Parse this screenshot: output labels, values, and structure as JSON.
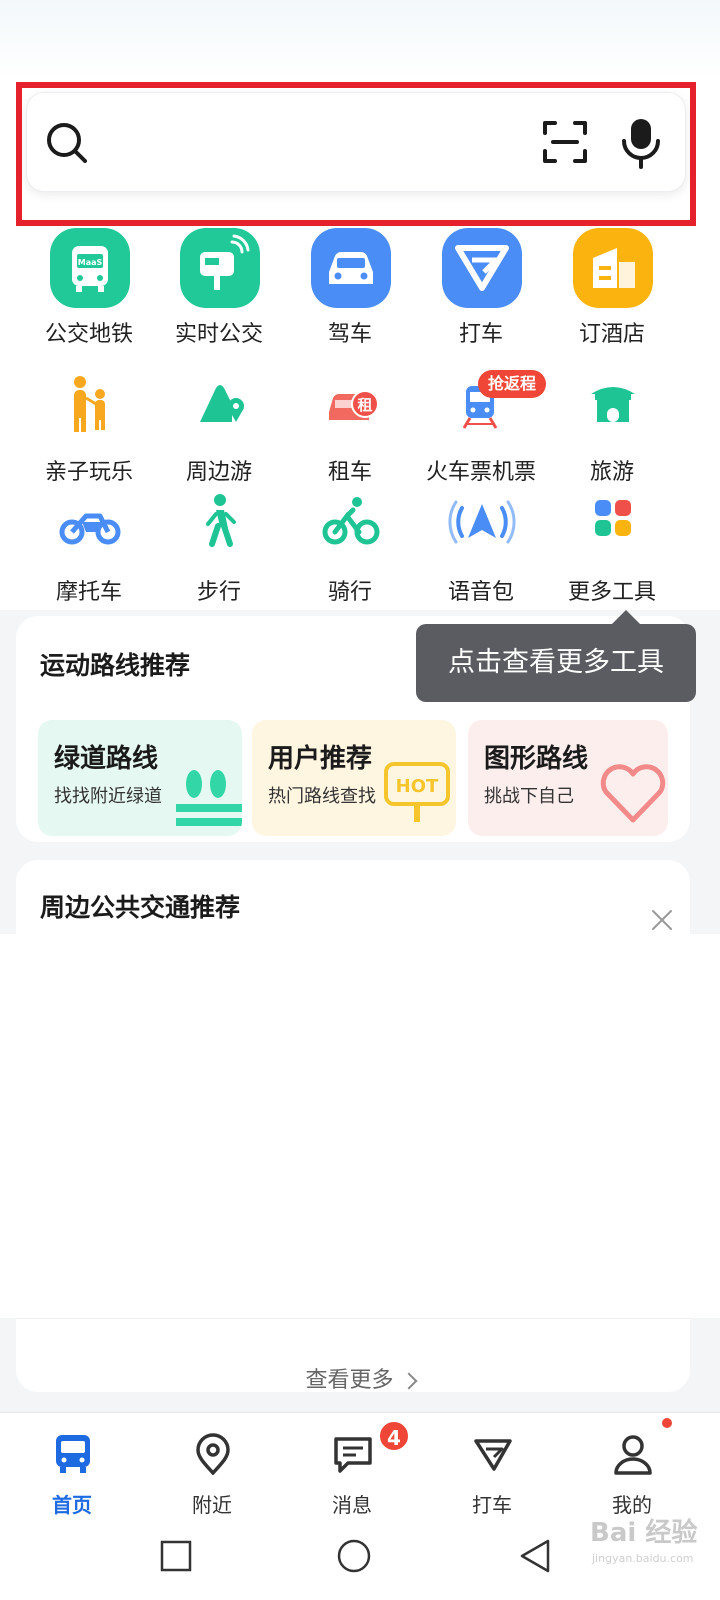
{
  "grid_items": [
    {
      "label": "公交地铁",
      "icon": "bus-metro-icon",
      "tile_text": "MaaS"
    },
    {
      "label": "实时公交",
      "icon": "realtime-bus-icon"
    },
    {
      "label": "驾车",
      "icon": "car-icon"
    },
    {
      "label": "打车",
      "icon": "taxi-icon"
    },
    {
      "label": "订酒店",
      "icon": "hotel-icon"
    },
    {
      "label": "亲子玩乐",
      "icon": "family-icon"
    },
    {
      "label": "周边游",
      "icon": "nearby-trip-icon"
    },
    {
      "label": "租车",
      "icon": "rent-car-icon",
      "tile_text": "租"
    },
    {
      "label": "火车票机票",
      "icon": "train-ticket-icon"
    },
    {
      "label": "旅游",
      "icon": "travel-icon"
    },
    {
      "label": "摩托车",
      "icon": "motorcycle-icon"
    },
    {
      "label": "步行",
      "icon": "walk-icon"
    },
    {
      "label": "骑行",
      "icon": "cycling-icon"
    },
    {
      "label": "语音包",
      "icon": "voice-pack-icon"
    },
    {
      "label": "更多工具",
      "icon": "more-tools-icon"
    }
  ],
  "return_badge": "抢返程",
  "tooltip": "点击查看更多工具",
  "sport_routes": {
    "title": "运动路线推荐",
    "cards": [
      {
        "title": "绿道路线",
        "subtitle": "找找附近绿道",
        "icon": "greenway-icon"
      },
      {
        "title": "用户推荐",
        "subtitle": "热门路线查找",
        "icon": "hot-sign-icon",
        "tag": "HOT"
      },
      {
        "title": "图形路线",
        "subtitle": "挑战下自己",
        "icon": "heart-route-icon"
      }
    ]
  },
  "transit": {
    "title": "周边公共交通推荐",
    "see_more": "查看更多"
  },
  "tabs": [
    {
      "label": "首页",
      "icon": "home-bus-icon",
      "active": true
    },
    {
      "label": "附近",
      "icon": "location-pin-icon"
    },
    {
      "label": "消息",
      "icon": "message-icon"
    },
    {
      "label": "打车",
      "icon": "taxi-tab-icon"
    },
    {
      "label": "我的",
      "icon": "profile-icon"
    }
  ],
  "message_badge": "4",
  "watermark": {
    "main": "Bai 经验",
    "sub": "jingyan.baidu.com"
  },
  "colors": {
    "highlight": "#e5222b",
    "accent": "#1e6ae0",
    "badge": "#ef4637",
    "tooltip": "#5a5c61"
  }
}
